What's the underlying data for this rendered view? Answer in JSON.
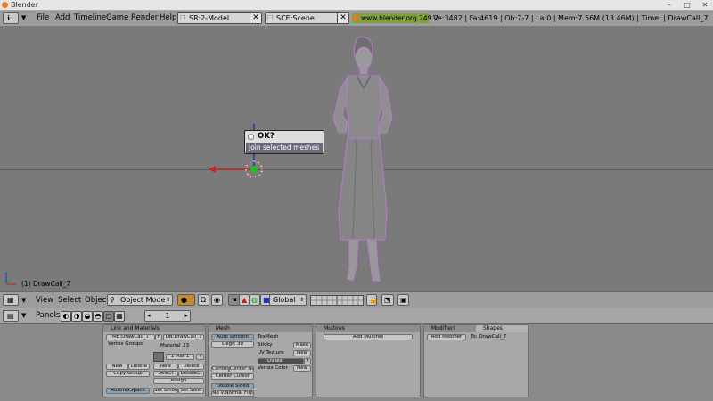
{
  "window": {
    "title": "Blender"
  },
  "menu": {
    "items": [
      "File",
      "Add",
      "Timeline",
      "Game",
      "Render",
      "Help"
    ],
    "screen_field": "SR:2-Model",
    "scene_field": "SCE:Scene",
    "site": "www.blender.org 249.2",
    "stats": "Ve:3482 | Fa:4619 | Ob:7-7 | La:0  | Mem:7.56M (13.46M)  | Time: | DrawCall_7"
  },
  "viewport": {
    "popup_title": "OK?",
    "popup_item": "Join selected meshes",
    "object_label": "(1) DrawCall_7"
  },
  "viewport_header": {
    "menus": [
      "View",
      "Select",
      "Object"
    ],
    "mode": "Object Mode",
    "orientation": "Global"
  },
  "buttons_header": {
    "panels_label": "Panels",
    "frame": "1"
  },
  "panels": {
    "link": {
      "title": "Link and Materials",
      "me": "ME:DrawCall_7",
      "f": "F",
      "ob": "OB:DrawCall_7",
      "vertex_groups": "Vertex Groups",
      "material": "Material_23",
      "mat_count": "1 Mat 1",
      "new": "New",
      "delete": "Delete",
      "copy_group": "Copy Group",
      "new2": "New",
      "delete2": "Delete",
      "select": "Select",
      "deselect": "Deselect",
      "assign": "Assign",
      "autotexspace": "AutoTexSpace",
      "set_smooth": "Set Smooth",
      "set_solid": "Set Solid"
    },
    "mesh": {
      "title": "Mesh",
      "auto_smooth": "Auto Smooth",
      "degr": "Degr: 30",
      "texmesh": "TexMesh",
      "sticky": "Sticky",
      "make": "Make",
      "uv_texture": "UV Texture",
      "new": "New",
      "uvtex": "UVTex",
      "vertex_color": "Vertex Color",
      "new2": "New",
      "centre": "Center",
      "centre_new": "Center New",
      "centre_cursor": "Center Cursor",
      "double_sided": "Double Sided",
      "no_v_normal_flip": "No V.Normal Flip"
    },
    "multires": {
      "title": "Multires",
      "add": "Add Multires"
    },
    "modifiers": {
      "tab1": "Modifiers",
      "tab2": "Shapes",
      "add": "Add Modifier",
      "to": "To: DrawCall_7"
    }
  },
  "colors": {
    "viewport_bg": "#7a7a7a",
    "header_bg": "#9d9d9d",
    "site_green": "#7ea33c",
    "selection_purple": "#b97bd1"
  }
}
